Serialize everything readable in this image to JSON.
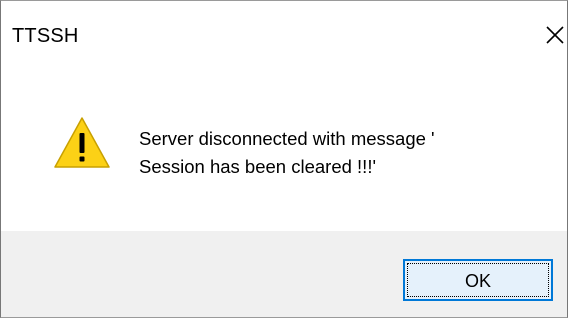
{
  "window": {
    "title": "TTSSH",
    "close_icon": "close-icon"
  },
  "message": {
    "icon": "warning-icon",
    "line1": "Server disconnected with message '",
    "line2": "Session has been cleared !!!'"
  },
  "buttons": {
    "ok_label": "OK"
  },
  "colors": {
    "warning_fill": "#fcd116",
    "button_border": "#0078d7",
    "button_bg": "#e5f1fb",
    "footer_bg": "#f0f0f0"
  }
}
